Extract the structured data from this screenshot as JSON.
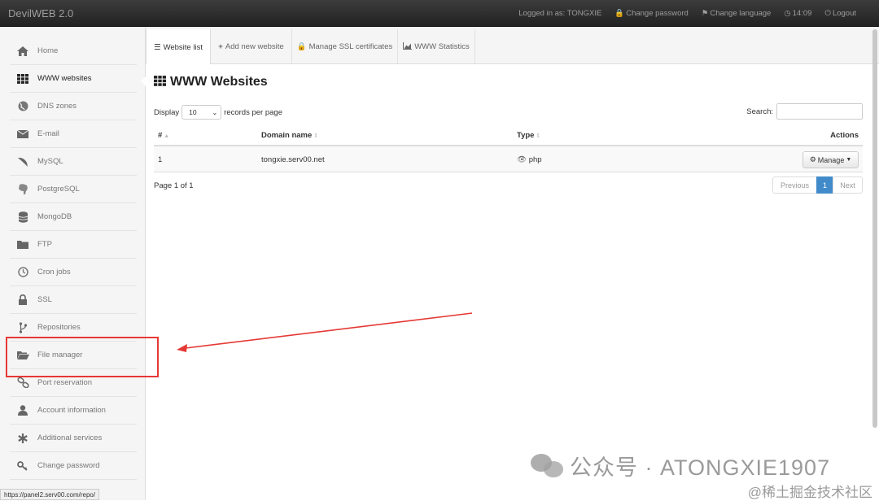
{
  "navbar": {
    "brand_prefix": "Devil",
    "brand_suffix": "WEB 2.0",
    "logged_in": "Logged in as: TONGXIE",
    "change_password": "Change password",
    "change_language": "Change language",
    "time": "14:09",
    "logout": "Logout"
  },
  "sidebar": {
    "items": [
      {
        "label": "Home",
        "icon": "home-icon"
      },
      {
        "label": "WWW websites",
        "icon": "grid-icon",
        "active": true
      },
      {
        "label": "DNS zones",
        "icon": "globe-icon"
      },
      {
        "label": "E-mail",
        "icon": "envelope-icon"
      },
      {
        "label": "MySQL",
        "icon": "dolphin-icon"
      },
      {
        "label": "PostgreSQL",
        "icon": "elephant-icon"
      },
      {
        "label": "MongoDB",
        "icon": "database-icon"
      },
      {
        "label": "FTP",
        "icon": "folder-icon"
      },
      {
        "label": "Cron jobs",
        "icon": "clock-icon"
      },
      {
        "label": "SSL",
        "icon": "lock-icon"
      },
      {
        "label": "Repositories",
        "icon": "branch-icon"
      },
      {
        "label": "File manager",
        "icon": "folder-open-icon"
      },
      {
        "label": "Port reservation",
        "icon": "link-icon"
      },
      {
        "label": "Account information",
        "icon": "user-icon"
      },
      {
        "label": "Additional services",
        "icon": "asterisk-icon"
      },
      {
        "label": "Change password",
        "icon": "key-icon"
      }
    ]
  },
  "tabs": [
    {
      "label": "Website list",
      "icon": "list-icon"
    },
    {
      "label": "Add new website",
      "icon": "plus-icon"
    },
    {
      "label": "Manage SSL certificates",
      "icon": "lock-icon"
    },
    {
      "label": "WWW Statistics",
      "icon": "chart-icon"
    }
  ],
  "main": {
    "title": "WWW Websites",
    "display_label": "Display",
    "page_length": "10",
    "records_label": "records per page",
    "search_label": "Search:",
    "columns": [
      "#",
      "Domain name",
      "Type",
      "Actions"
    ],
    "rows": [
      {
        "num": "1",
        "domain": "tongxie.serv00.net",
        "type": "php",
        "action": "Manage"
      }
    ],
    "info": "Page 1 of 1",
    "pager": {
      "prev": "Previous",
      "page": "1",
      "next": "Next"
    }
  },
  "status_url": "https://panel2.serv00.com/repo/",
  "watermark": {
    "main": "公众号 · ATONGXIE1907",
    "secondary": "@稀土掘金技术社区"
  },
  "colors": {
    "accent": "#428bca",
    "annotation": "#e53935"
  }
}
